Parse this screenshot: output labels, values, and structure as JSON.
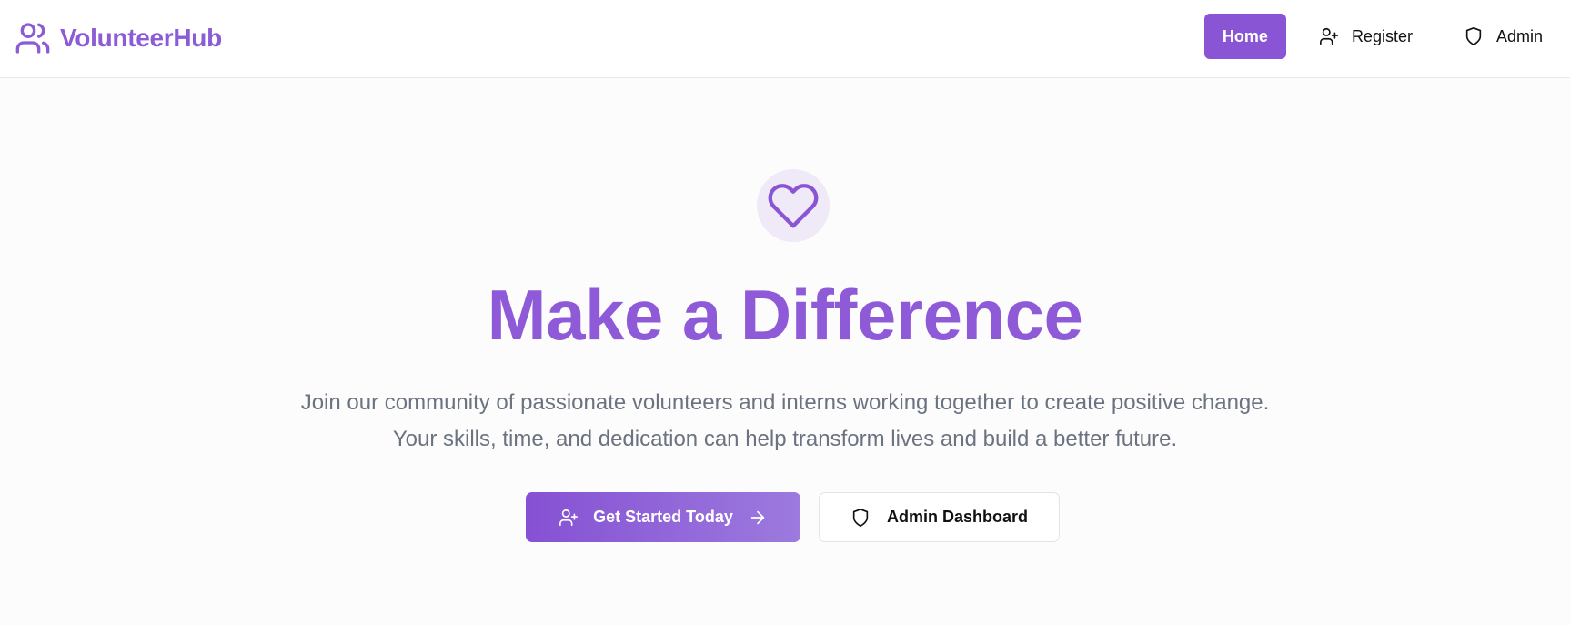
{
  "brand": {
    "name": "VolunteerHub",
    "icon": "users-icon"
  },
  "nav": {
    "home_label": "Home",
    "register_label": "Register",
    "register_icon": "user-plus-icon",
    "admin_label": "Admin",
    "admin_icon": "shield-icon"
  },
  "hero": {
    "icon": "heart-icon",
    "title": "Make a Difference",
    "subtitle_line1": "Join our community of passionate volunteers and interns working together to create positive change.",
    "subtitle_line2": "Your skills, time, and dedication can help transform lives and build a better future.",
    "primary_cta_label": "Get Started Today",
    "primary_cta_icon": "user-plus-icon",
    "primary_cta_trailing_icon": "arrow-right-icon",
    "secondary_cta_label": "Admin Dashboard",
    "secondary_cta_icon": "shield-icon"
  },
  "colors": {
    "accent": "#8a55d5",
    "title": "#8f5ad8",
    "icon_circle": "#efe9f8",
    "subtitle_text": "#6b7280",
    "background": "#fcfcfc"
  }
}
